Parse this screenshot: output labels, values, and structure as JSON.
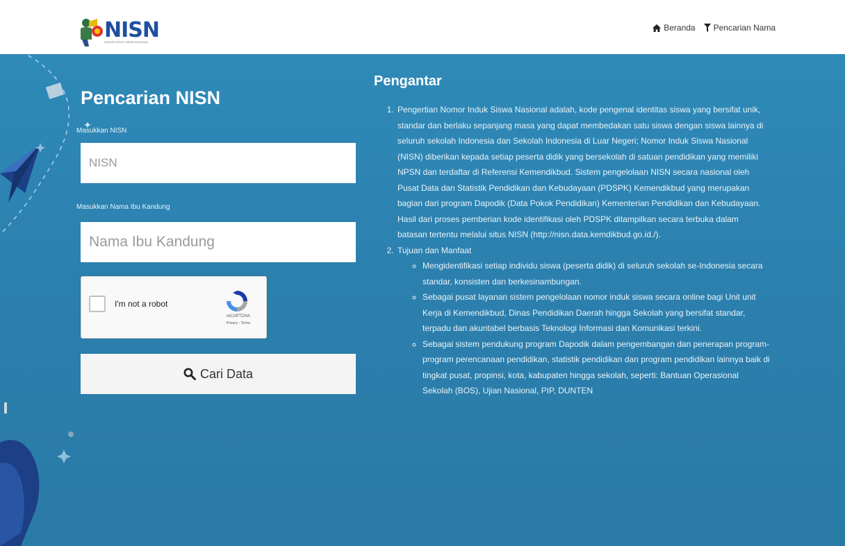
{
  "header": {
    "logo_text": "NISN",
    "logo_subtext": "NOMOR INDUK SISWA NASIONAL",
    "nav": [
      {
        "label": "Beranda",
        "icon": "home-icon"
      },
      {
        "label": "Pencarian Nama",
        "icon": "filter-icon"
      }
    ]
  },
  "form": {
    "title": "Pencarian NISN",
    "nisn_label": "Masukkan NISN",
    "nisn_placeholder": "NISN",
    "nisn_value": "",
    "mother_label": "Masukkan Nama Ibu Kandung",
    "mother_placeholder": "Nama Ibu Kandung",
    "mother_value": "",
    "recaptcha": {
      "label": "I'm not a robot",
      "brand": "reCAPTCHA",
      "links": "Privacy - Terms"
    },
    "search_button": "Cari Data",
    "search_icon": "search-icon"
  },
  "intro": {
    "title": "Pengantar",
    "items": [
      {
        "text": "Pengertian Nomor Induk Siswa Nasional adalah, kode pengenal identitas siswa yang bersifat unik, standar dan berlaku sepanjang masa yang dapat membedakan satu siswa dengan siswa lainnya di seluruh sekolah Indonesia dan Sekolah Indonesia di Luar Negeri; Nomor Induk Siswa Nasional (NISN) diberikan kepada setiap peserta didik yang bersekolah di satuan pendidikan yang memiliki NPSN dan terdaftar di Referensi Kemendikbud. Sistem pengelolaan NISN secara nasional oleh Pusat Data dan Statistik Pendidikan dan Kebudayaan (PDSPK) Kemendikbud yang merupakan bagian dari program Dapodik (Data Pokok Pendidikan) Kementerian Pendidikan dan Kebudayaan. Hasil dari proses pemberian kode identifikasi oleh PDSPK ditampilkan secara terbuka dalam batasan tertentu melalui situs NISN (http://nisn.data.kemdikbud.go.id./)."
      },
      {
        "text": "Tujuan dan Manfaat",
        "sub": [
          "Mengidentifikasi setiap individu siswa (peserta didik) di seluruh sekolah se-Indonesia secara standar, konsisten dan berkesinambungan.",
          "Sebagai pusat layanan sistem pengelolaan nomor induk siswa secara online bagi Unit unit Kerja di Kemendikbud, Dinas Pendidikan Daerah hingga Sekolah yang bersifat standar, terpadu dan akuntabel berbasis Teknologi Informasi dan Komunikasi terkini.",
          "Sebagai sistem pendukung program Dapodik dalam pengembangan dan penerapan program-program perencanaan pendidikan, statistik pendidikan dan program pendidikan lainnya baik di tingkat pusat, propinsi, kota, kabupaten hingga sekolah, seperti: Bantuan Operasional Sekolah (BOS), Ujian Nasional, PIP, DUNTEN"
        ]
      }
    ]
  },
  "colors": {
    "hero_bg": "#2c80ae",
    "brand": "#1f4fa0",
    "accent_dark": "#1c3f86"
  }
}
